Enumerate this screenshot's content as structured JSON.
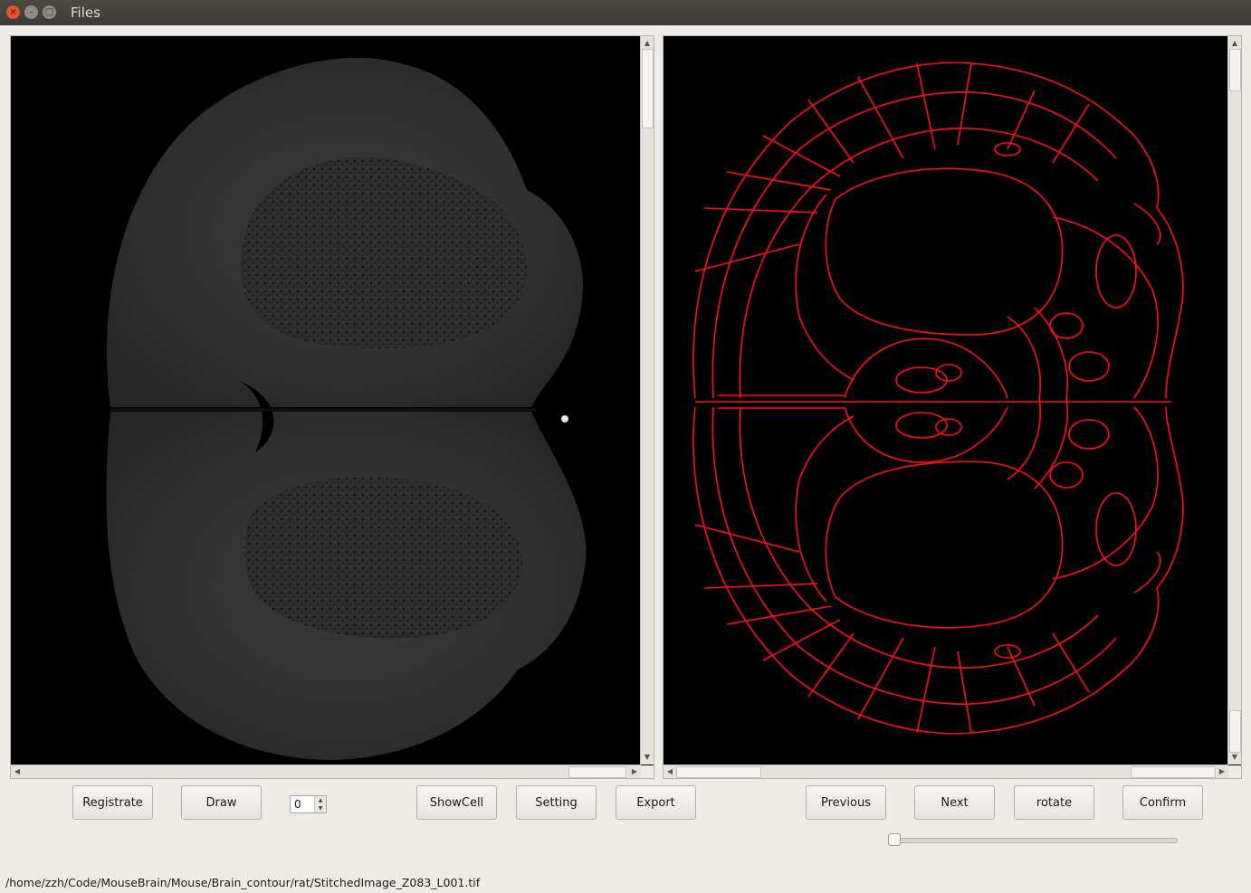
{
  "window": {
    "title": "Files",
    "close_glyph": "×",
    "minimize_glyph": "–",
    "maximize_glyph": "□"
  },
  "toolbar": {
    "registrate_label": "Registrate",
    "draw_label": "Draw",
    "spin_value": "0",
    "showcell_label": "ShowCell",
    "setting_label": "Setting",
    "export_label": "Export",
    "previous_label": "Previous",
    "next_label": "Next",
    "rotate_label": "rotate",
    "confirm_label": "Confirm"
  },
  "slider": {
    "value": 0
  },
  "scroll": {
    "up_arrow": "▲",
    "down_arrow": "▼",
    "left_arrow": "◀",
    "right_arrow": "▶"
  },
  "status": {
    "path": "/home/zzh/Code/MouseBrain/Mouse/Brain_contour/rat/StitchedImage_Z083_L001.tif"
  },
  "colors": {
    "contour": "#ff1010",
    "titlebar": "#3c3b37",
    "background": "#efebe7"
  },
  "icons": {
    "close": "close-icon",
    "minimize": "minimize-icon",
    "maximize": "maximize-icon"
  }
}
